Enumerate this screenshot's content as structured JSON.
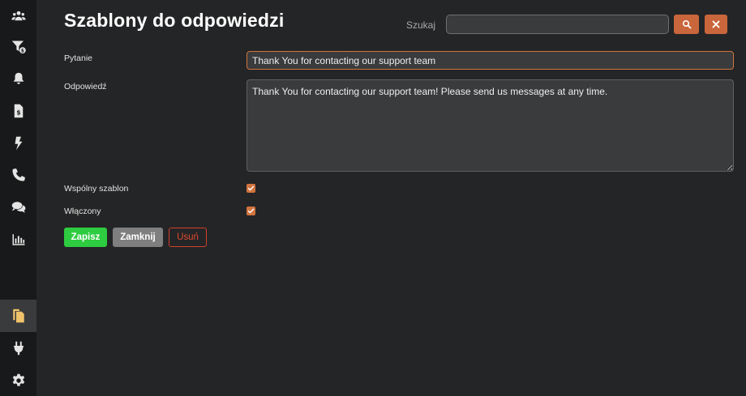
{
  "sidebar": {
    "items": [
      {
        "icon": "users-icon"
      },
      {
        "icon": "filter-dollar-icon"
      },
      {
        "icon": "bell-icon"
      },
      {
        "icon": "invoice-icon"
      },
      {
        "icon": "bolt-icon"
      },
      {
        "icon": "phone-icon"
      },
      {
        "icon": "comments-icon"
      },
      {
        "icon": "chart-bar-icon"
      },
      {
        "icon": "copy-icon",
        "active": true
      },
      {
        "icon": "plug-icon"
      },
      {
        "icon": "gear-icon"
      }
    ]
  },
  "header": {
    "title": "Szablony do odpowiedzi",
    "search_label": "Szukaj",
    "search_value": "",
    "search_button_icon": "search-icon",
    "clear_button_icon": "close-icon"
  },
  "form": {
    "question_label": "Pytanie",
    "question_value": "Thank You for contacting our support team",
    "answer_label": "Odpowiedź",
    "answer_value": "Thank You for contacting our support team! Please send us messages at any time.",
    "shared_label": "Wspólny szablon",
    "shared_checked": true,
    "enabled_label": "Włączony",
    "enabled_checked": true
  },
  "actions": {
    "save_label": "Zapisz",
    "close_label": "Zamknij",
    "delete_label": "Usuń"
  },
  "colors": {
    "accent": "#d2743f",
    "save": "#2ecc40",
    "close": "#7f7f7f",
    "delete": "#e0492f",
    "active_icon": "#f0c36b"
  }
}
